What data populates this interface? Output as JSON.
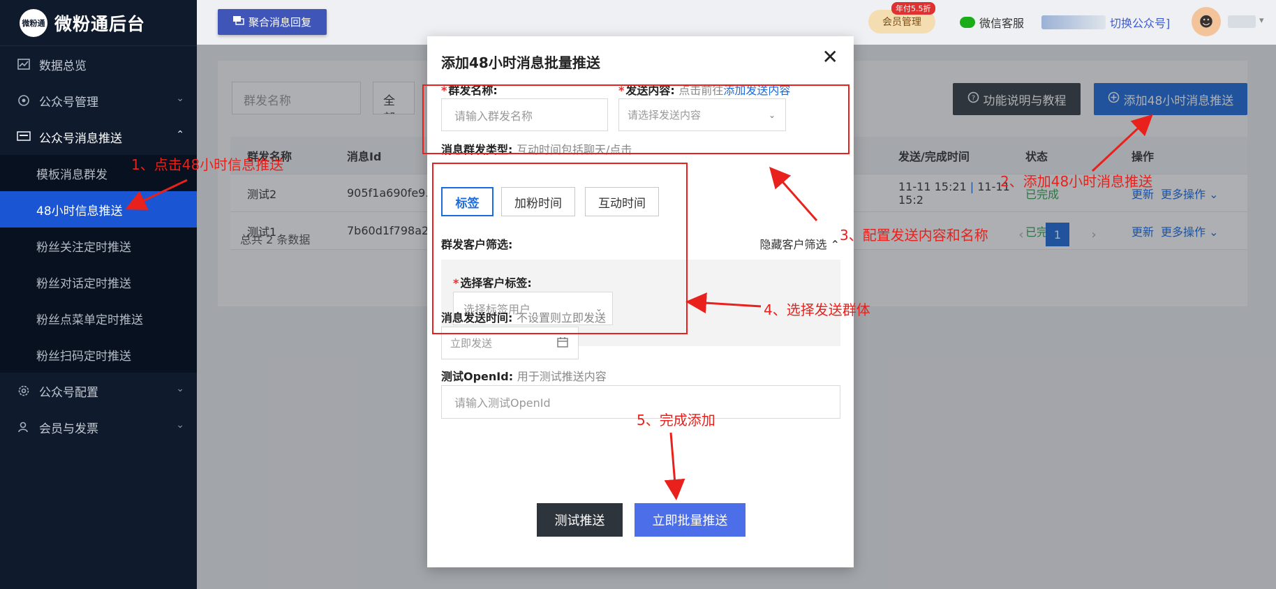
{
  "sidebar": {
    "logo_badge": "微粉通",
    "logo_text": "微粉通后台",
    "items": [
      {
        "label": "数据总览"
      },
      {
        "label": "公众号管理"
      },
      {
        "label": "公众号消息推送"
      },
      {
        "label": "公众号配置"
      },
      {
        "label": "会员与发票"
      }
    ],
    "sub_items": [
      {
        "label": "模板消息群发"
      },
      {
        "label": "48小时信息推送"
      },
      {
        "label": "粉丝关注定时推送"
      },
      {
        "label": "粉丝对话定时推送"
      },
      {
        "label": "粉丝点菜单定时推送"
      },
      {
        "label": "粉丝扫码定时推送"
      }
    ]
  },
  "header": {
    "aggregate_btn": "聚合消息回复",
    "vip_label": "会员管理",
    "vip_tag": "年付5.5折",
    "wx_service": "微信客服",
    "switch_account": "切换公众号]"
  },
  "content": {
    "filter_name_placeholder": "群发名称",
    "filter_status": "全部",
    "guide_btn": "功能说明与教程",
    "add_btn": "添加48小时消息推送",
    "columns": [
      "群发名称",
      "消息Id",
      "发送/完成时间",
      "状态",
      "操作"
    ],
    "rows": [
      {
        "name": "测试2",
        "id": "905f1a690fe9...",
        "time": "11-11 15:21",
        "time2": "11-11 15:2",
        "status": "已完成"
      },
      {
        "name": "测试1",
        "id": "7b60d1f798a2...",
        "time": "",
        "time2": "",
        "status": "已完成"
      }
    ],
    "op_update": "更新",
    "op_more": "更多操作",
    "total": "总共 2 条数据",
    "page": "1"
  },
  "modal": {
    "title": "添加48小时消息批量推送",
    "name_label": "群发名称:",
    "name_placeholder": "请输入群发名称",
    "content_label": "发送内容:",
    "content_hint": "点击前往",
    "content_link": "添加发送内容",
    "content_placeholder": "请选择发送内容",
    "type_label": "消息群发类型:",
    "type_hint": "互动时间包括聊天/点击",
    "types": [
      "标签",
      "加粉时间",
      "互动时间"
    ],
    "filter_label": "群发客户筛选:",
    "filter_toggle": "隐藏客户筛选",
    "tag_label": "选择客户标签:",
    "tag_placeholder": "选择标签用户",
    "time_label": "消息发送时间:",
    "time_hint": "不设置则立即发送",
    "time_placeholder": "立即发送",
    "openid_label": "测试OpenId:",
    "openid_hint": "用于测试推送内容",
    "openid_placeholder": "请输入测试OpenId",
    "btn_test": "测试推送",
    "btn_push": "立即批量推送"
  },
  "annotations": {
    "a1": "1、点击48小时信息推送",
    "a2": "2、添加48小时消息推送",
    "a3": "3、配置发送内容和名称",
    "a4": "4、选择发送群体",
    "a5": "5、完成添加"
  },
  "colors": {
    "sidebar_bg": "#0f1a2c",
    "active_blue": "#1a56d4",
    "primary": "#1c6bdb",
    "annotation_red": "#e8211c"
  }
}
